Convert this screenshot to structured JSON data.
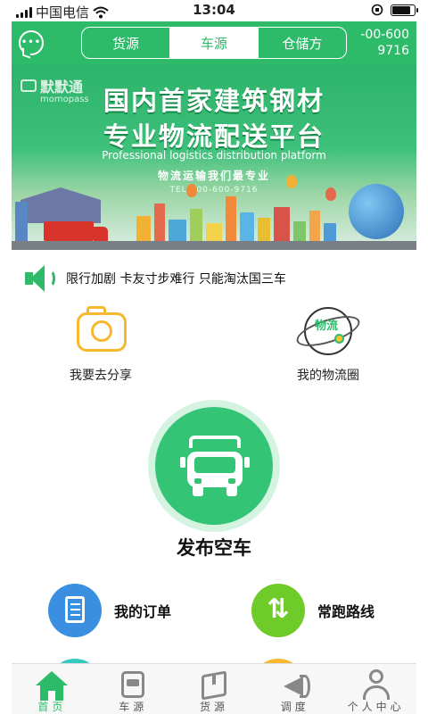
{
  "status_bar": {
    "carrier": "中国电信",
    "time": "13:04",
    "battery_level": 0.85
  },
  "header": {
    "tabs": [
      {
        "label": "货源",
        "active": false
      },
      {
        "label": "车源",
        "active": true
      },
      {
        "label": "仓储方",
        "active": false
      }
    ],
    "hotline_line1": "-00-600",
    "hotline_line2": "9716",
    "accent_color": "#2dbb6a"
  },
  "banner": {
    "brand_name": "默默通",
    "brand_sub": "momopass",
    "title_line1": "国内首家建筑钢材",
    "title_line2": "专业物流配送平台",
    "english": "Professional logistics distribution platform",
    "slogan": "物流运输我们最专业",
    "tel": "TEL:400-600-9716"
  },
  "notice": {
    "text": "限行加剧 卡友寸步难行 只能淘汰国三车"
  },
  "quick_actions": [
    {
      "label": "我要去分享",
      "icon": "camera-icon"
    },
    {
      "label": "我的物流圈",
      "icon": "logistics-circle-icon",
      "icon_text": "物流"
    }
  ],
  "publish": {
    "label": "发布空车"
  },
  "bottom_actions": [
    {
      "label": "我的订单",
      "icon": "document-icon",
      "color": "#3a8fe0"
    },
    {
      "label": "常跑路线",
      "icon": "route-arrows-icon",
      "color": "#6fcb2a"
    }
  ],
  "tab_bar": [
    {
      "label": "首页",
      "active": true
    },
    {
      "label": "车源",
      "active": false
    },
    {
      "label": "货源",
      "active": false
    },
    {
      "label": "调度",
      "active": false
    },
    {
      "label": "个人中心",
      "active": false
    }
  ]
}
